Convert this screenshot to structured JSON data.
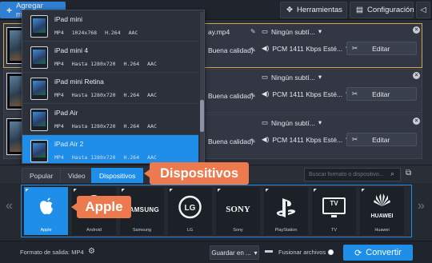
{
  "toolbar": {
    "add_media": "Agregar medio",
    "tools": "Herramientas",
    "settings": "Configuración"
  },
  "files": [
    {
      "name": "ay.mp4",
      "quality": "Buena calidad)",
      "subtitle": "Ningún subtí...",
      "audio": "PCM 1411 Kbps Esté...",
      "edit": "Editar"
    },
    {
      "name": "",
      "quality": "Buena calidad)",
      "subtitle": "Ningún subtí...",
      "audio": "PCM 1411 Kbps Esté...",
      "edit": "Editar"
    },
    {
      "name": "",
      "quality": "Buena calidad)",
      "subtitle": "Ningún subtí...",
      "audio": "PCM 1411 Kbps Esté...",
      "edit": "Editar"
    }
  ],
  "dropdown": [
    {
      "name": "iPad mini",
      "fmt": "MP4",
      "res": "1024x768",
      "codec": "H.264",
      "audio": "AAC"
    },
    {
      "name": "iPad mini 4",
      "fmt": "MP4",
      "res": "Hasta 1280x720",
      "codec": "H.264",
      "audio": "AAC"
    },
    {
      "name": "iPad mini Retina",
      "fmt": "MP4",
      "res": "Hasta 1280x720",
      "codec": "H.264",
      "audio": "AAC"
    },
    {
      "name": "iPad Air",
      "fmt": "MP4",
      "res": "Hasta 1280x720",
      "codec": "H.264",
      "audio": "AAC"
    },
    {
      "name": "iPad Air 2",
      "fmt": "MP4",
      "res": "Hasta 1280x720",
      "codec": "H.264",
      "audio": "AAC"
    }
  ],
  "tabs": {
    "popular": "Popular",
    "video": "Video",
    "devices": "Dispositivos"
  },
  "search": {
    "placeholder": "Buscar formato o dispositivo..."
  },
  "devices": [
    {
      "logo": "",
      "label": "Apple"
    },
    {
      "logo": "",
      "label": "Android"
    },
    {
      "logo": "SAMSUNG",
      "label": "Samsung"
    },
    {
      "logo": "LG",
      "label": "LG"
    },
    {
      "logo": "SONY",
      "label": "Sony"
    },
    {
      "logo": "",
      "label": "PlayStation"
    },
    {
      "logo": "TV",
      "label": "TV"
    },
    {
      "logo": "HUAWEI",
      "label": "Huawei"
    }
  ],
  "callouts": {
    "devices": "Dispositivos",
    "apple": "Apple"
  },
  "bottom": {
    "output_format": "Formato de salida: MP4",
    "save_to": "Guardar en ...",
    "merge": "Fusionar archivos",
    "convert": "Convertir"
  },
  "colors": {
    "accent": "#1e8ee8",
    "callout": "#ec7a4e",
    "selected_border": "#d4a64a"
  }
}
